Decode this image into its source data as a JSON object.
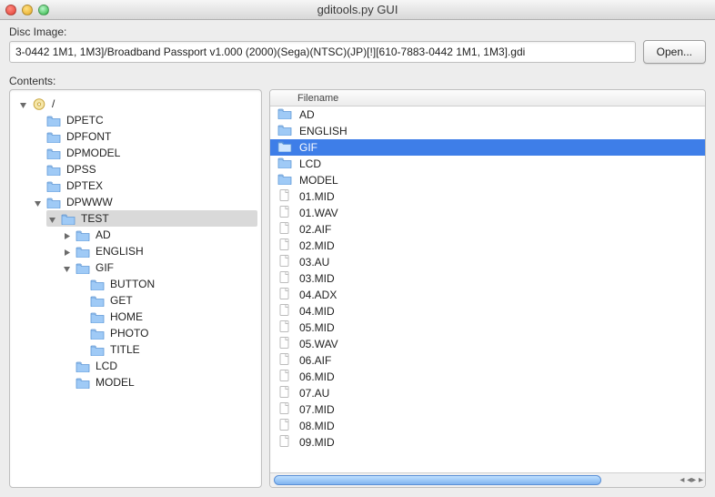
{
  "window": {
    "title": "gditools.py GUI"
  },
  "disc_image": {
    "label": "Disc Image:",
    "value": "3-0442 1M1, 1M3]/Broadband Passport v1.000 (2000)(Sega)(NTSC)(JP)[!][610-7883-0442 1M1, 1M3].gdi",
    "open_label": "Open..."
  },
  "contents_label": "Contents:",
  "list_header": "Filename",
  "tree": {
    "root_label": "/",
    "items": [
      {
        "label": "DPETC",
        "type": "folder",
        "children": null
      },
      {
        "label": "DPFONT",
        "type": "folder",
        "children": null
      },
      {
        "label": "DPMODEL",
        "type": "folder",
        "children": null
      },
      {
        "label": "DPSS",
        "type": "folder",
        "children": null
      },
      {
        "label": "DPTEX",
        "type": "folder",
        "children": null
      },
      {
        "label": "DPWWW",
        "type": "folder",
        "open": true,
        "children": [
          {
            "label": "TEST",
            "type": "folder",
            "open": true,
            "selected": true,
            "children": [
              {
                "label": "AD",
                "type": "folder",
                "hasChildren": true,
                "children": null
              },
              {
                "label": "ENGLISH",
                "type": "folder",
                "hasChildren": true,
                "children": null
              },
              {
                "label": "GIF",
                "type": "folder",
                "open": true,
                "children": [
                  {
                    "label": "BUTTON",
                    "type": "folder",
                    "children": null
                  },
                  {
                    "label": "GET",
                    "type": "folder",
                    "children": null
                  },
                  {
                    "label": "HOME",
                    "type": "folder",
                    "children": null
                  },
                  {
                    "label": "PHOTO",
                    "type": "folder",
                    "children": null
                  },
                  {
                    "label": "TITLE",
                    "type": "folder",
                    "children": null
                  }
                ]
              },
              {
                "label": "LCD",
                "type": "folder",
                "children": null
              },
              {
                "label": "MODEL",
                "type": "folder",
                "children": null
              }
            ]
          }
        ]
      }
    ]
  },
  "filelist": [
    {
      "label": "AD",
      "type": "folder"
    },
    {
      "label": "ENGLISH",
      "type": "folder"
    },
    {
      "label": "GIF",
      "type": "folder",
      "selected": true
    },
    {
      "label": "LCD",
      "type": "folder"
    },
    {
      "label": "MODEL",
      "type": "folder"
    },
    {
      "label": "01.MID",
      "type": "file"
    },
    {
      "label": "01.WAV",
      "type": "file"
    },
    {
      "label": "02.AIF",
      "type": "file"
    },
    {
      "label": "02.MID",
      "type": "file"
    },
    {
      "label": "03.AU",
      "type": "file"
    },
    {
      "label": "03.MID",
      "type": "file"
    },
    {
      "label": "04.ADX",
      "type": "file"
    },
    {
      "label": "04.MID",
      "type": "file"
    },
    {
      "label": "05.MID",
      "type": "file"
    },
    {
      "label": "05.WAV",
      "type": "file"
    },
    {
      "label": "06.AIF",
      "type": "file"
    },
    {
      "label": "06.MID",
      "type": "file"
    },
    {
      "label": "07.AU",
      "type": "file"
    },
    {
      "label": "07.MID",
      "type": "file"
    },
    {
      "label": "08.MID",
      "type": "file"
    },
    {
      "label": "09.MID",
      "type": "file"
    }
  ]
}
